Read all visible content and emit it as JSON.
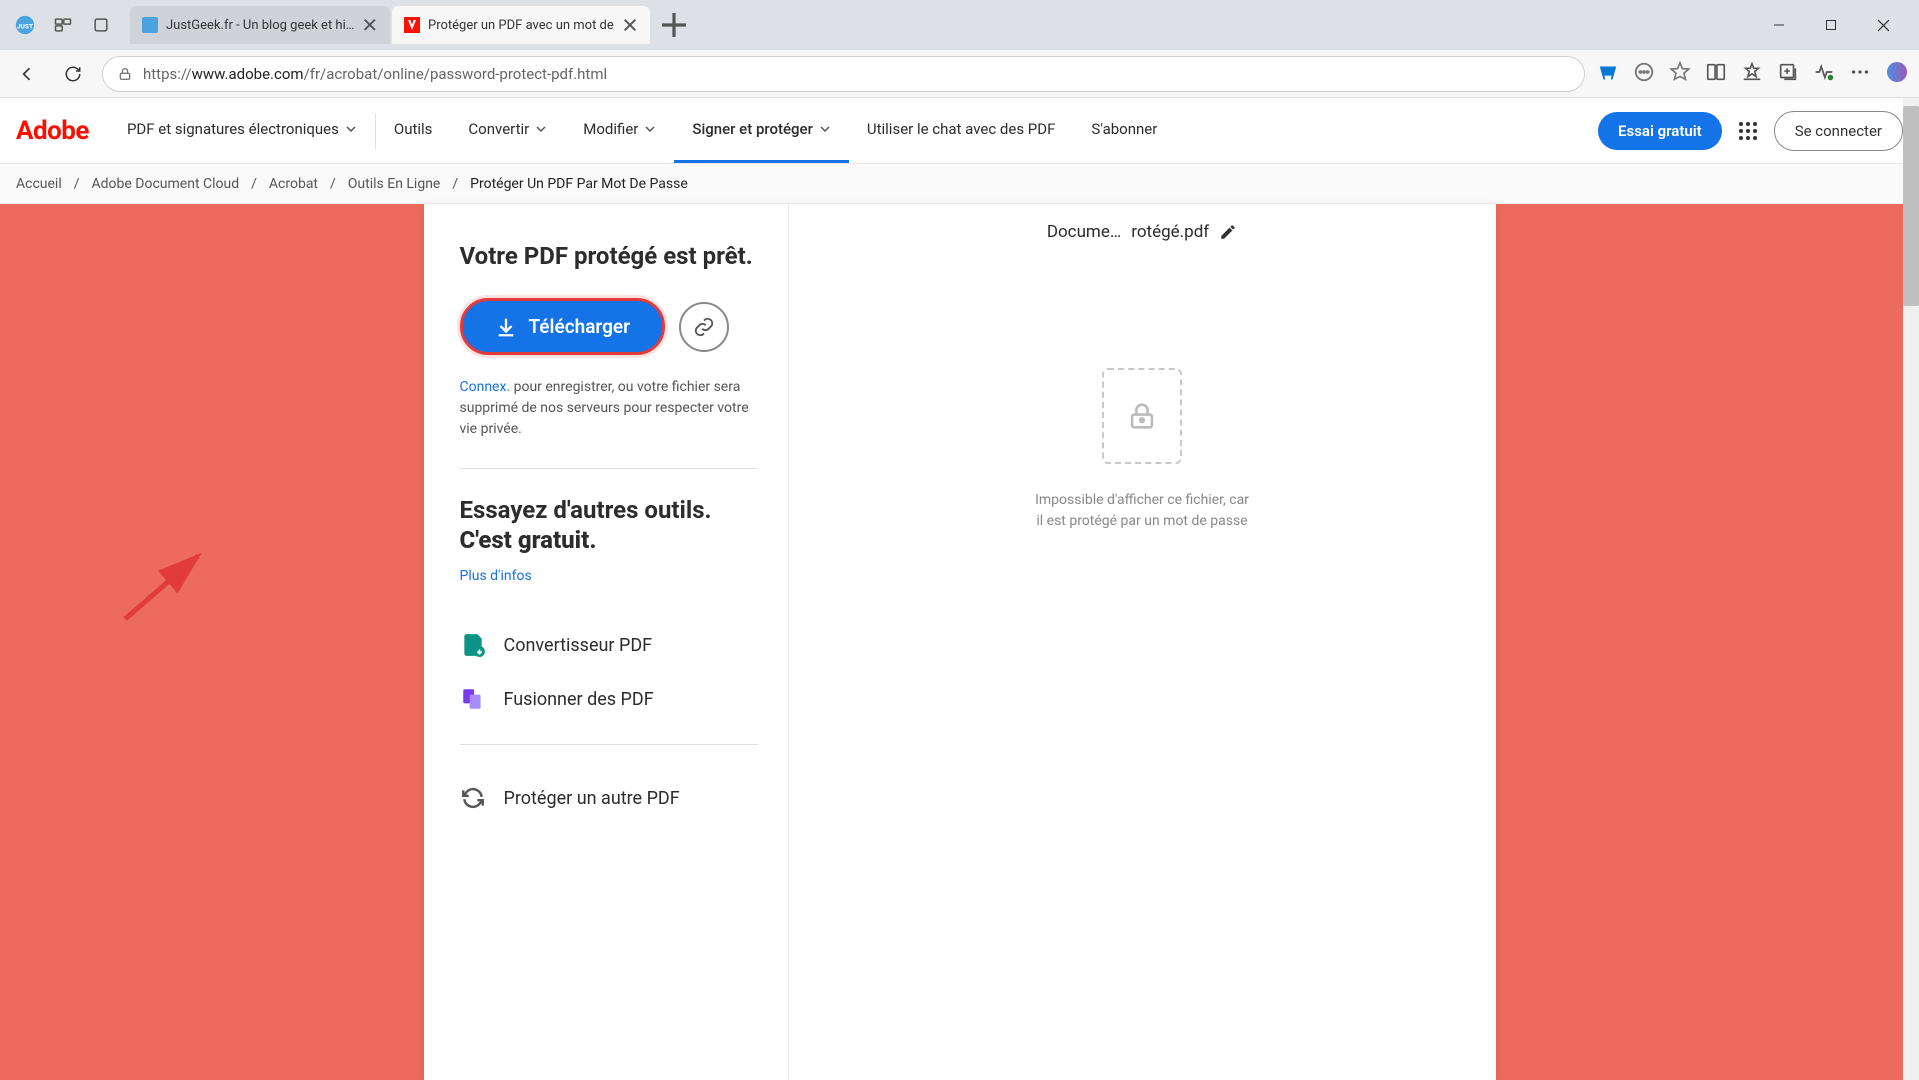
{
  "browser": {
    "tabs": [
      {
        "title": "JustGeek.fr - Un blog geek et high"
      },
      {
        "title": "Protéger un PDF avec un mot de"
      }
    ],
    "url_prefix": "https://",
    "url_host": "www.adobe.com",
    "url_path": "/fr/acrobat/online/password-protect-pdf.html"
  },
  "header": {
    "logo": "Adobe",
    "nav": [
      {
        "label": "PDF et signatures électroniques",
        "dropdown": true
      },
      {
        "label": "Outils",
        "dropdown": false
      },
      {
        "label": "Convertir",
        "dropdown": true
      },
      {
        "label": "Modifier",
        "dropdown": true
      },
      {
        "label": "Signer et protéger",
        "dropdown": true,
        "active": true
      },
      {
        "label": "Utiliser le chat avec des PDF",
        "dropdown": false
      },
      {
        "label": "S'abonner",
        "dropdown": false
      }
    ],
    "trial_btn": "Essai gratuit",
    "login_btn": "Se connecter"
  },
  "breadcrumb": {
    "items": [
      "Accueil",
      "Adobe Document Cloud",
      "Acrobat",
      "Outils En Ligne"
    ],
    "current": "Protéger Un PDF Par Mot De Passe"
  },
  "panel": {
    "title": "Votre PDF protégé est prêt.",
    "download_label": "Télécharger",
    "info_link": "Connex.",
    "info_rest": " pour enregistrer, ou votre fichier sera supprimé de nos serveurs pour respecter votre vie privée.",
    "subtitle_a": "Essayez d'autres outils. ",
    "subtitle_b": "C'est gratuit.",
    "more_link": "Plus d'infos",
    "tools": [
      {
        "label": "Convertisseur PDF"
      },
      {
        "label": "Fusionner des PDF"
      }
    ],
    "again_label": "Protéger un autre PDF"
  },
  "preview": {
    "filename_a": "Docume…",
    "filename_b": "rotégé.pdf",
    "message": "Impossible d'afficher ce fichier, car il est protégé par un mot de passe"
  },
  "colors": {
    "accent": "#1473e6",
    "adobe_red": "#fa0f00",
    "bg_coral": "#ed6a5e",
    "highlight_red": "#e23b3b"
  }
}
